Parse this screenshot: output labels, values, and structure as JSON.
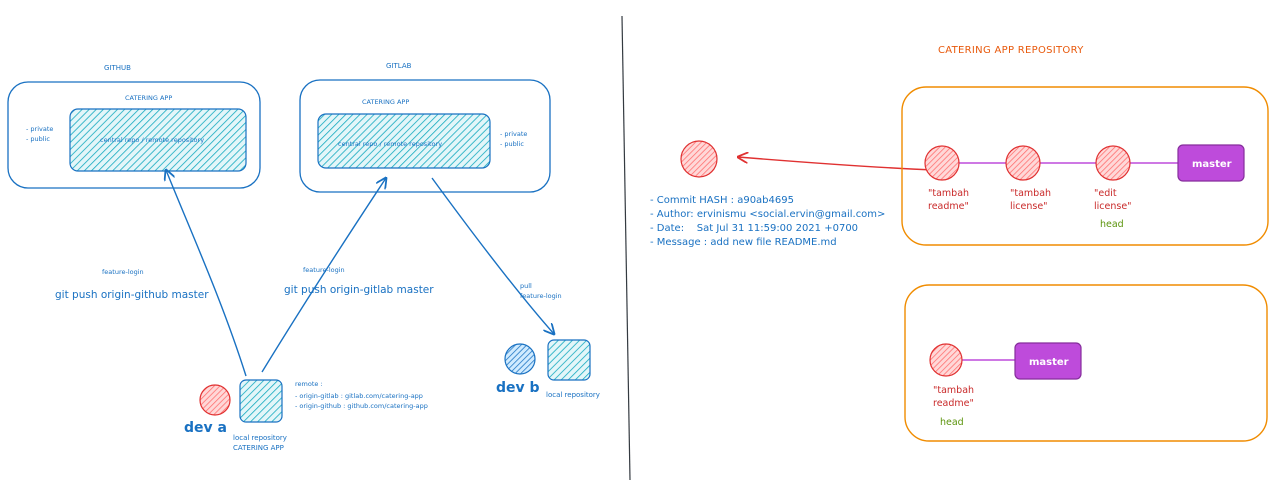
{
  "colors": {
    "blue": "#1971c2",
    "teal_fill": "#15aabf",
    "red_fill": "#ff8787",
    "red_stroke": "#e03131",
    "orange": "#f08c00",
    "purple": "#be4bdb",
    "green": "#5c940d"
  },
  "left": {
    "github": {
      "title": "GITHUB",
      "repo_name": "CATERING APP",
      "repo_label": "central repo / remote repository",
      "visibility": [
        "- private",
        "- public"
      ]
    },
    "gitlab": {
      "title": "GITLAB",
      "repo_name": "CATERING APP",
      "repo_label": "central repo / remote repository",
      "visibility": [
        "- private",
        "- public"
      ]
    },
    "push_github": {
      "branch": "feature-login",
      "command": "git push origin-github master"
    },
    "push_gitlab": {
      "branch": "feature-login",
      "command": "git push origin-gitlab master"
    },
    "pull": {
      "action": "pull",
      "branch": "feature-login"
    },
    "dev_a": {
      "name": "dev a",
      "repo_line1": "local repository",
      "repo_line2": "CATERING APP",
      "remote_title": "remote :",
      "remotes": [
        "- origin-gitlab : gitlab.com/catering-app",
        "- origin-github : github.com/catering-app"
      ]
    },
    "dev_b": {
      "name": "dev b",
      "repo_label": "local repository"
    }
  },
  "right": {
    "title": "CATERING APP REPOSITORY",
    "commit_info": [
      "- Commit HASH : a90ab4695",
      "- Author: ervinismu <social.ervin@gmail.com>",
      "- Date:    Sat Jul 31 11:59:00 2021 +0700",
      "- Message : add new file README.md"
    ],
    "repo1": {
      "commits": [
        {
          "line1": "\"tambah",
          "line2": "readme\""
        },
        {
          "line1": "\"tambah",
          "line2": "license\""
        },
        {
          "line1": "\"edit",
          "line2": "license\""
        }
      ],
      "head_label": "head",
      "branch": "master"
    },
    "repo2": {
      "commits": [
        {
          "line1": "\"tambah",
          "line2": "readme\""
        }
      ],
      "head_label": "head",
      "branch": "master"
    }
  }
}
